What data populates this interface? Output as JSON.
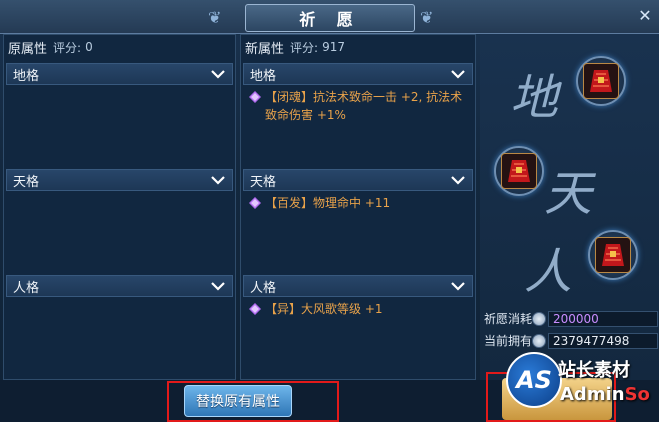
{
  "window": {
    "title": "祈 愿"
  },
  "left_column": {
    "header": "原属性",
    "score_label": "评分:",
    "score_value": "0",
    "sections": [
      {
        "label": "地格",
        "attrs": []
      },
      {
        "label": "天格",
        "attrs": []
      },
      {
        "label": "人格",
        "attrs": []
      }
    ]
  },
  "right_column": {
    "header": "新属性",
    "score_label": "评分:",
    "score_value": "917",
    "sections": [
      {
        "label": "地格",
        "attrs": [
          "【闭魂】抗法术致命一击 +2, 抗法术致命伤害 +1%"
        ]
      },
      {
        "label": "天格",
        "attrs": [
          "【百发】物理命中 +11"
        ]
      },
      {
        "label": "人格",
        "attrs": [
          "【异】大风歌等级 +1"
        ]
      }
    ]
  },
  "right_panel": {
    "brush_chars": [
      "地",
      "天",
      "人"
    ],
    "cost_label": "祈愿消耗",
    "cost_value": "200000",
    "owned_label": "当前拥有",
    "owned_value": "2379477498"
  },
  "bottom": {
    "replace_button": "替换原有属性"
  },
  "watermark": {
    "logo": "AS",
    "line1": "站长素材",
    "line2_a": "Admin",
    "line2_b": "So"
  },
  "colors": {
    "attr_text": "#e8a24a",
    "cost_purple": "#c98dff",
    "highlight_red": "#e21a1a",
    "button_blue": "#2f76b6"
  },
  "icons": [
    "close-icon",
    "chevron-down-icon",
    "purple-gem-icon",
    "coin-icon",
    "plus-icon",
    "armor-relic-icon"
  ]
}
